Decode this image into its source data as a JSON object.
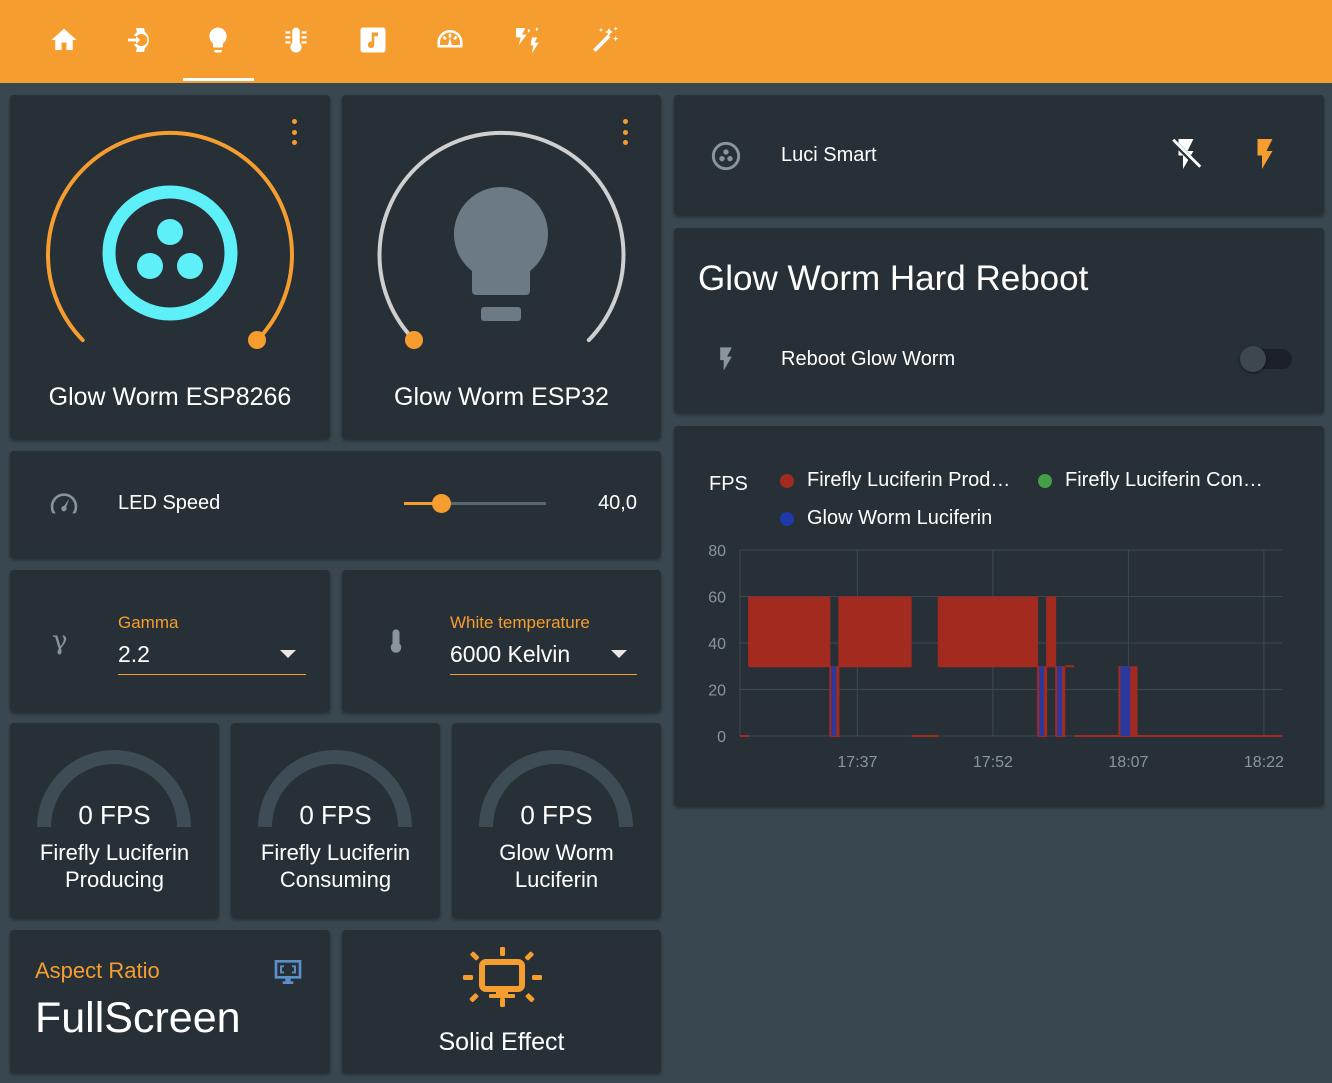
{
  "topbar": {
    "color": "#f59d2e",
    "tabs": [
      {
        "icon": "home-icon",
        "active": false
      },
      {
        "icon": "watch-login-icon",
        "active": false
      },
      {
        "icon": "lightbulb-icon",
        "active": true
      },
      {
        "icon": "thermometer-icon",
        "active": false
      },
      {
        "icon": "music-box-icon",
        "active": false
      },
      {
        "icon": "gauge-icon",
        "active": false
      },
      {
        "icon": "flash-auto-icon",
        "active": false
      },
      {
        "icon": "magic-wand-icon",
        "active": false
      }
    ]
  },
  "lights": [
    {
      "name": "Glow Worm ESP8266",
      "state": "on",
      "brightness_percent": 100,
      "icon": "luciferin-icon",
      "icon_color": "#5ef0f8"
    },
    {
      "name": "Glow Worm ESP32",
      "state": "off",
      "brightness_percent": 0,
      "icon": "lightbulb-icon",
      "icon_color": "#6b7a85"
    }
  ],
  "led_speed": {
    "label": "LED Speed",
    "value_text": "40,0",
    "value": 40,
    "min": 0,
    "max": 100,
    "icon": "speedometer-icon"
  },
  "gamma": {
    "label": "Gamma",
    "value": "2.2",
    "icon": "gamma-icon"
  },
  "white_temp": {
    "label": "White temperature",
    "value": "6000 Kelvin",
    "icon": "thermometer-icon"
  },
  "gauges": [
    {
      "value": "0 FPS",
      "name_line1": "Firefly Luciferin",
      "name_line2": "Producing",
      "level": 0
    },
    {
      "value": "0 FPS",
      "name_line1": "Firefly Luciferin",
      "name_line2": "Consuming",
      "level": 0
    },
    {
      "value": "0 FPS",
      "name_line1": "Glow Worm",
      "name_line2": "Luciferin",
      "level": 0
    }
  ],
  "aspect": {
    "label": "Aspect Ratio",
    "value": "FullScreen",
    "icon": "monitor-screenshot-icon"
  },
  "effect": {
    "label": "Solid Effect",
    "icon": "monitor-sun-icon"
  },
  "luci": {
    "name": "Luci Smart",
    "icon": "luciferin-icon",
    "off_icon": "flash-off-icon",
    "on_icon": "flash-icon"
  },
  "reboot": {
    "title": "Glow Worm Hard Reboot",
    "row_label": "Reboot Glow Worm",
    "state": "off",
    "icon": "flash-icon"
  },
  "chart_data": {
    "type": "line",
    "ylabel": "FPS",
    "ylim": [
      0,
      80
    ],
    "yticks": [
      "80",
      "60",
      "40",
      "20",
      "0"
    ],
    "xticks": [
      "17:37",
      "17:52",
      "18:07",
      "18:22"
    ],
    "series": [
      {
        "name": "Firefly Luciferin Prod…",
        "color": "#a32a1e"
      },
      {
        "name": "Firefly Luciferin Con…",
        "color": "#43a047"
      },
      {
        "name": "Glow Worm Luciferin",
        "color": "#1f3aa8"
      }
    ],
    "segments": [
      {
        "start": "17:24",
        "end": "17:25",
        "min": 0,
        "max": 0
      },
      {
        "start": "17:25",
        "end": "17:34",
        "min": 30,
        "max": 60
      },
      {
        "start": "17:34",
        "end": "17:35",
        "min": 0,
        "max": 30
      },
      {
        "start": "17:35",
        "end": "17:43",
        "min": 30,
        "max": 60
      },
      {
        "start": "17:43",
        "end": "17:46",
        "min": 0,
        "max": 0
      },
      {
        "start": "17:46",
        "end": "17:57",
        "min": 30,
        "max": 60
      },
      {
        "start": "17:57",
        "end": "17:58",
        "min": 0,
        "max": 30
      },
      {
        "start": "17:58",
        "end": "17:59",
        "min": 30,
        "max": 60
      },
      {
        "start": "17:59",
        "end": "18:00",
        "min": 0,
        "max": 30
      },
      {
        "start": "18:00",
        "end": "18:01",
        "min": 30,
        "max": 30
      },
      {
        "start": "18:01",
        "end": "18:06",
        "min": 0,
        "max": 0
      },
      {
        "start": "18:06",
        "end": "18:08",
        "min": 0,
        "max": 30
      },
      {
        "start": "18:08",
        "end": "18:24",
        "min": 0,
        "max": 0
      }
    ]
  }
}
